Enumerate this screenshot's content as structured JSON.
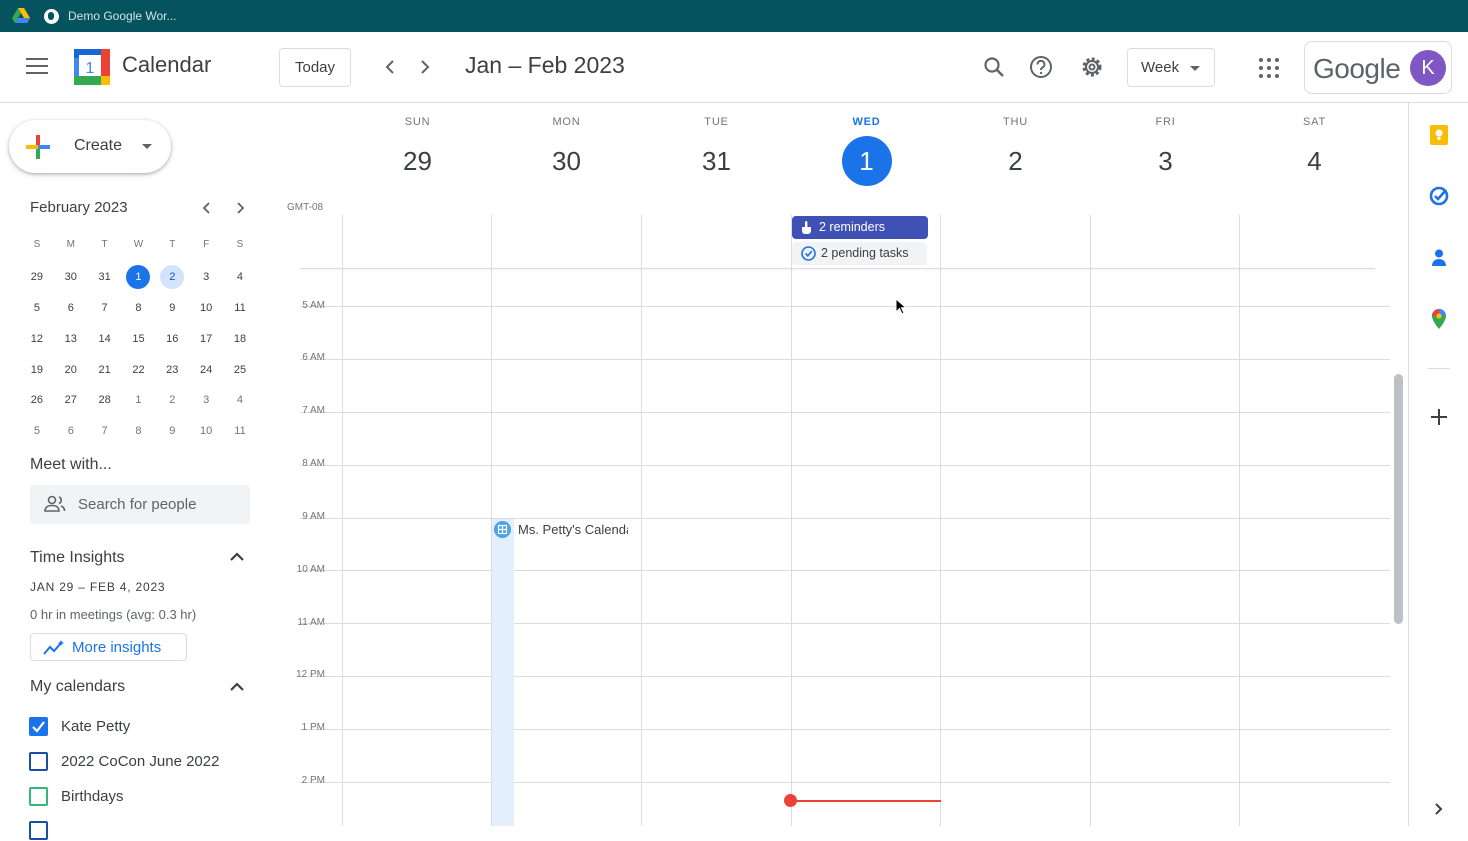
{
  "browser": {
    "tab_title": "Demo Google Wor..."
  },
  "header": {
    "app_name": "Calendar",
    "today_label": "Today",
    "date_range": "Jan – Feb 2023",
    "view_label": "Week",
    "logo_day": "1",
    "google_word": "Google",
    "avatar_initial": "K"
  },
  "sidebar": {
    "create_label": "Create",
    "mini_month": "February 2023",
    "mini_weekdays": [
      "S",
      "M",
      "T",
      "W",
      "T",
      "F",
      "S"
    ],
    "mini_weeks": [
      [
        "29",
        "30",
        "31",
        "1",
        "2",
        "3",
        "4"
      ],
      [
        "5",
        "6",
        "7",
        "8",
        "9",
        "10",
        "11"
      ],
      [
        "12",
        "13",
        "14",
        "15",
        "16",
        "17",
        "18"
      ],
      [
        "19",
        "20",
        "21",
        "22",
        "23",
        "24",
        "25"
      ],
      [
        "26",
        "27",
        "28",
        "1",
        "2",
        "3",
        "4"
      ],
      [
        "5",
        "6",
        "7",
        "8",
        "9",
        "10",
        "11"
      ]
    ],
    "meet_title": "Meet with...",
    "search_placeholder": "Search for people",
    "insights_title": "Time Insights",
    "insights_range": "JAN 29 – FEB 4, 2023",
    "insights_meetings": "0 hr in meetings (avg: 0.3 hr)",
    "more_insights_label": "More insights",
    "my_calendars_title": "My calendars",
    "calendars": [
      {
        "name": "Kate Petty",
        "checked": true,
        "color": "#1a73e8"
      },
      {
        "name": "2022 CoCon June 2022",
        "checked": false,
        "color": "#174ea6"
      },
      {
        "name": "Birthdays",
        "checked": false,
        "color": "#33b679"
      }
    ]
  },
  "week": {
    "days": [
      {
        "dow": "SUN",
        "num": "29"
      },
      {
        "dow": "MON",
        "num": "30"
      },
      {
        "dow": "TUE",
        "num": "31"
      },
      {
        "dow": "WED",
        "num": "1"
      },
      {
        "dow": "THU",
        "num": "2"
      },
      {
        "dow": "FRI",
        "num": "3"
      },
      {
        "dow": "SAT",
        "num": "4"
      }
    ],
    "timezone": "GMT-08",
    "hours": [
      "5 AM",
      "6 AM",
      "7 AM",
      "8 AM",
      "9 AM",
      "10 AM",
      "11 AM",
      "12 PM",
      "1 PM",
      "2 PM"
    ]
  },
  "events": {
    "reminders_chip": "2 reminders",
    "tasks_chip": "2 pending tasks",
    "event_title": "Ms. Petty's Calendar"
  },
  "colors": {
    "accent": "#1a73e8",
    "reminder_chip": "#3f51b5",
    "now_indicator": "#ea4335",
    "browser_bar": "#05535e"
  }
}
